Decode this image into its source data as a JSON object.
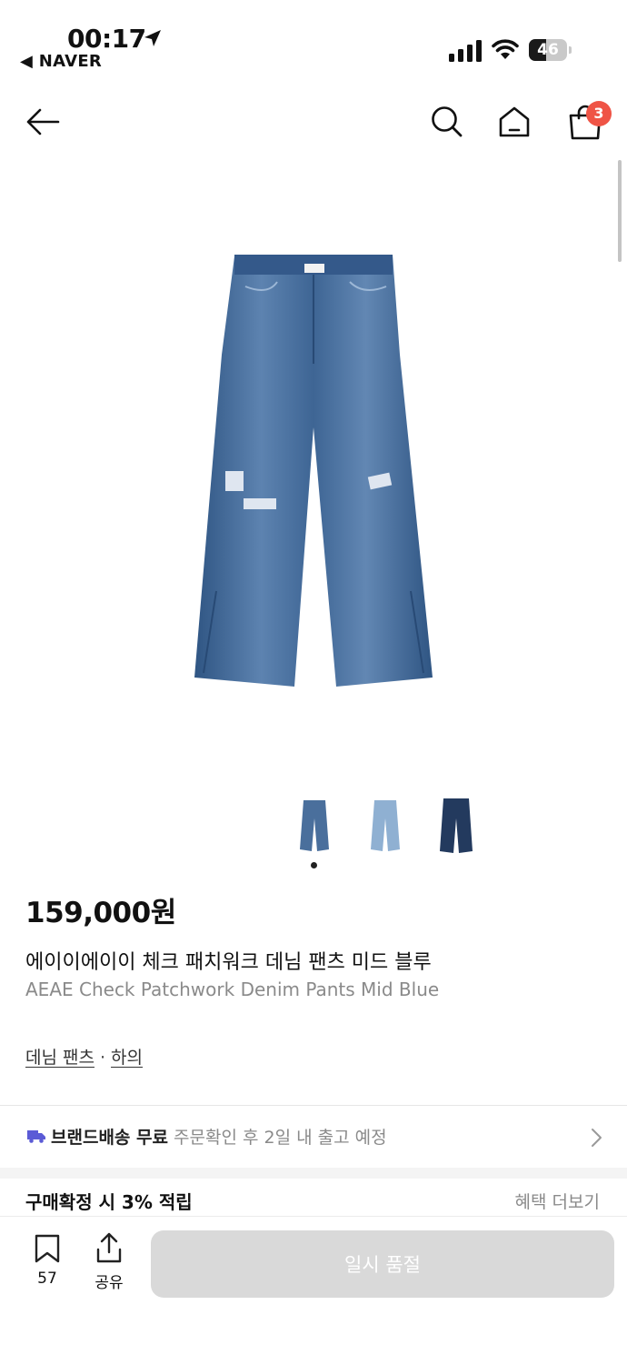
{
  "status_bar": {
    "time": "00:17",
    "back_app": "◀ NAVER",
    "battery": "46",
    "battery_level": 0.46
  },
  "header": {
    "cart_count": "3"
  },
  "product": {
    "price": "159,000원",
    "title_ko": "에이이에이이 체크 패치워크 데님 팬츠 미드 블루",
    "title_en": "AEAE Check Patchwork Denim Pants Mid Blue",
    "categories": [
      "데님 팬츠",
      "하의"
    ],
    "category_separator": "·",
    "thumbnails": [
      "mid-blue",
      "light-blue",
      "dark-blue"
    ],
    "active_thumbnail": 0
  },
  "shipping": {
    "free_label": "브랜드배송 무료",
    "schedule": "주문확인 후 2일 내 출고 예정"
  },
  "benefit": {
    "points_label": "구매확정 시 3% 적립",
    "more_label": "혜택 더보기"
  },
  "bottom_bar": {
    "bookmark_count": "57",
    "share_label": "공유",
    "soldout_label": "일시 품절"
  },
  "colors": {
    "accent_badge": "#ef5446",
    "denim_mid": "#4a6f9c",
    "denim_light": "#8fb0d2",
    "denim_dark": "#233a5e",
    "disabled_button": "#d9d9d9"
  }
}
